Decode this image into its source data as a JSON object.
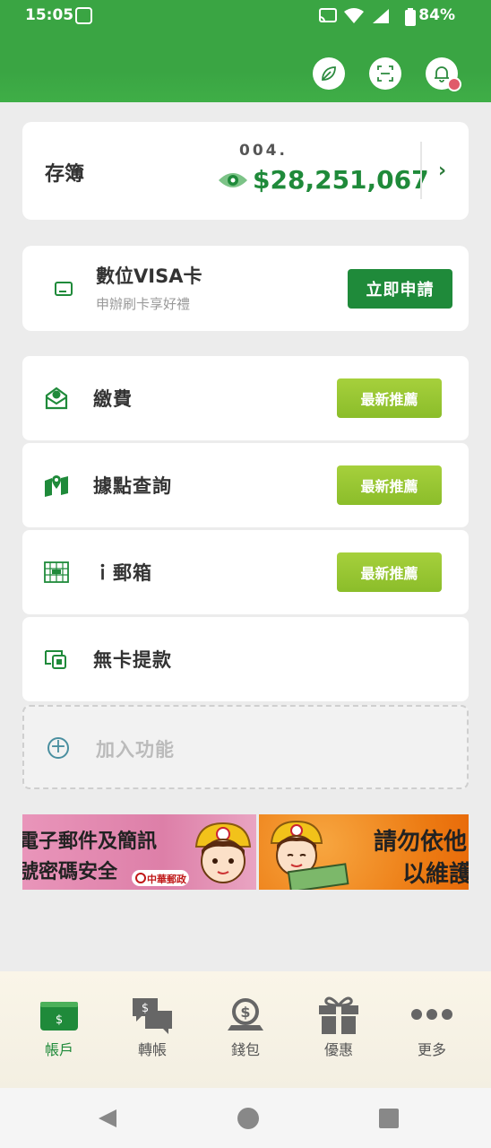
{
  "status_bar": {
    "time": "15:05",
    "battery": "84%"
  },
  "header": {
    "icons": [
      "leaf-icon",
      "scan-icon",
      "bell-icon"
    ]
  },
  "passbook": {
    "label": "存簿",
    "account": "004.",
    "balance": "$28,251,067",
    "chevron": "›"
  },
  "visa": {
    "title": "數位VISA卡",
    "subtitle": "申辦刷卡享好禮",
    "button": "立即申請"
  },
  "features": [
    {
      "label": "繳費",
      "badge": "最新推薦"
    },
    {
      "label": "據點查詢",
      "badge": "最新推薦"
    },
    {
      "label": "ｉ郵箱",
      "badge": "最新推薦"
    },
    {
      "label": "無卡提款"
    }
  ],
  "add_feature": {
    "label": "加入功能"
  },
  "banners": [
    {
      "line1": "電子郵件及簡訊",
      "line2": "號密碼安全",
      "logo": "中華郵政"
    },
    {
      "line1": "請勿依他",
      "line2": "以維護"
    }
  ],
  "bottom_nav": [
    {
      "label": "帳戶",
      "icon": "wallet-card-icon",
      "active": true
    },
    {
      "label": "轉帳",
      "icon": "transfer-chat-icon",
      "active": false
    },
    {
      "label": "錢包",
      "icon": "money-hand-icon",
      "active": false
    },
    {
      "label": "優惠",
      "icon": "gift-icon",
      "active": false
    },
    {
      "label": "更多",
      "icon": "more-dots-icon",
      "active": false
    }
  ],
  "colors": {
    "brand_green": "#3aa543",
    "dark_green": "#1f8a3a",
    "badge_green": "#9cc834"
  }
}
